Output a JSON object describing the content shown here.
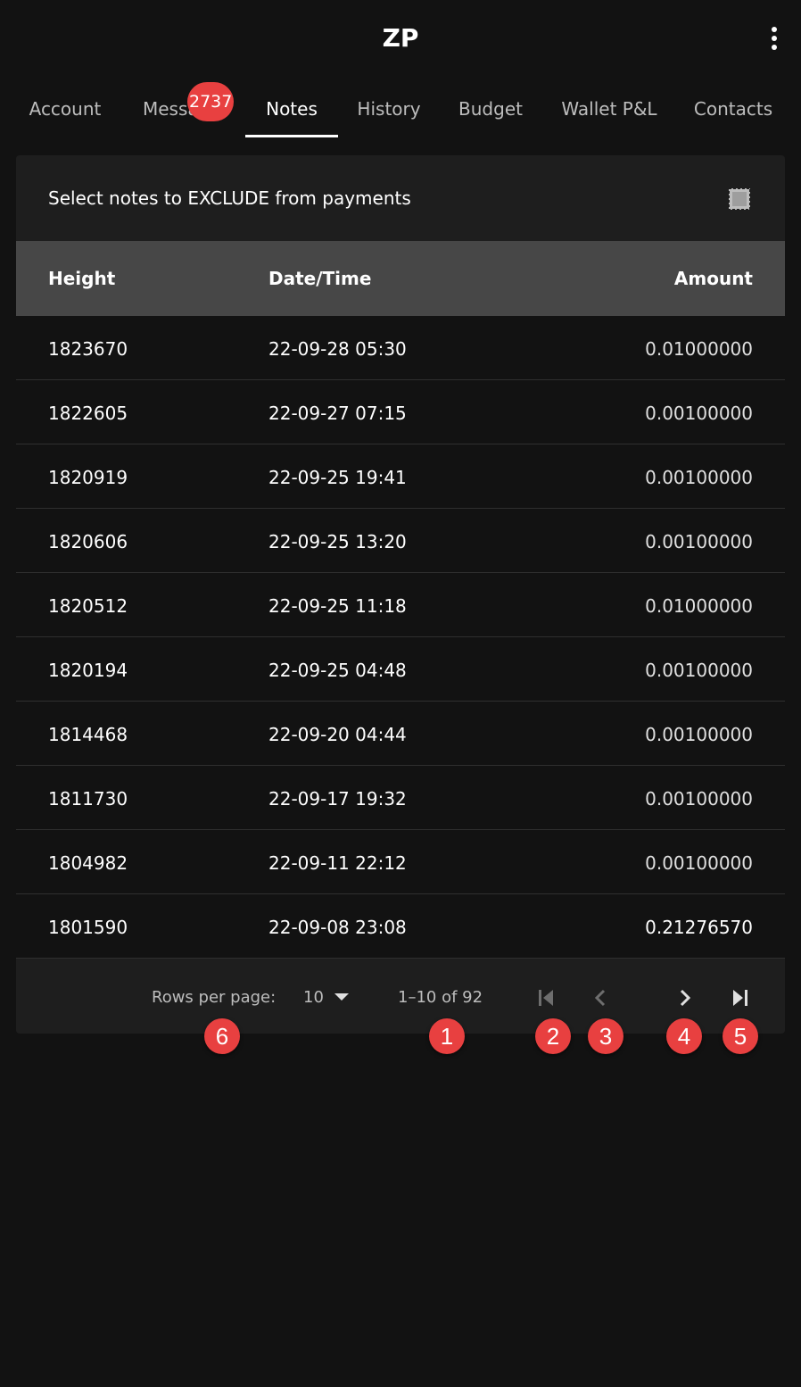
{
  "app": {
    "title": "ZP"
  },
  "tabs": [
    {
      "label": "Account"
    },
    {
      "label": "Messages",
      "badge": "2737"
    },
    {
      "label": "Notes",
      "active": true
    },
    {
      "label": "History"
    },
    {
      "label": "Budget"
    },
    {
      "label": "Wallet P&L"
    },
    {
      "label": "Contacts"
    }
  ],
  "notes": {
    "title": "Select notes to EXCLUDE from payments",
    "columns": {
      "height": "Height",
      "datetime": "Date/Time",
      "amount": "Amount"
    },
    "rows": [
      {
        "height": "1823670",
        "datetime": "22-09-28 05:30",
        "amount": "0.01000000"
      },
      {
        "height": "1822605",
        "datetime": "22-09-27 07:15",
        "amount": "0.00100000"
      },
      {
        "height": "1820919",
        "datetime": "22-09-25 19:41",
        "amount": "0.00100000"
      },
      {
        "height": "1820606",
        "datetime": "22-09-25 13:20",
        "amount": "0.00100000"
      },
      {
        "height": "1820512",
        "datetime": "22-09-25 11:18",
        "amount": "0.01000000"
      },
      {
        "height": "1820194",
        "datetime": "22-09-25 04:48",
        "amount": "0.00100000"
      },
      {
        "height": "1814468",
        "datetime": "22-09-20 04:44",
        "amount": "0.00100000"
      },
      {
        "height": "1811730",
        "datetime": "22-09-17 19:32",
        "amount": "0.00100000"
      },
      {
        "height": "1804982",
        "datetime": "22-09-11 22:12",
        "amount": "0.00100000"
      },
      {
        "height": "1801590",
        "datetime": "22-09-08 23:08",
        "amount": "0.21276570"
      }
    ],
    "footer": {
      "rows_per_page_label": "Rows per page:",
      "rows_per_page_value": "10",
      "range": "1–10 of 92"
    }
  },
  "markers": [
    "1",
    "2",
    "3",
    "4",
    "5",
    "6"
  ],
  "colors": {
    "background": "#121212",
    "surface": "#1e1e1e",
    "header": "#474747",
    "badge": "#e84040"
  }
}
